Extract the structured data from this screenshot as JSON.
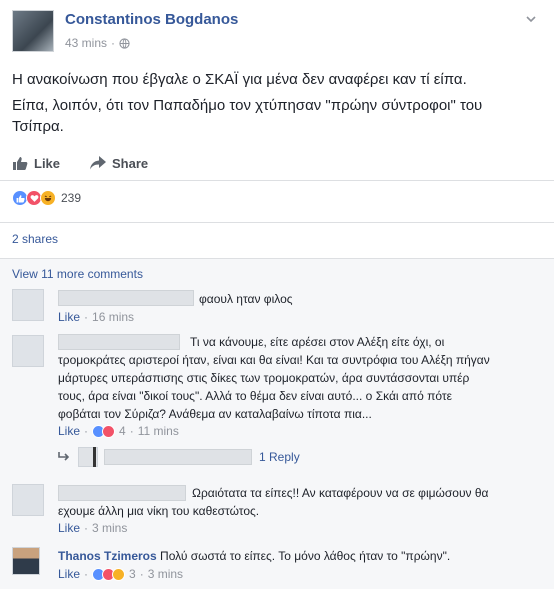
{
  "post": {
    "author": "Constantinos Bogdanos",
    "time": "43 mins",
    "sep": "·",
    "text1": "Η ανακοίνωση που έβγαλε ο ΣΚΑΪ για μένα δεν αναφέρει καν τί είπα.",
    "text2": "Είπα, λοιπόν, ότι τον Παπαδήμο τον χτύπησαν \"πρώην σύντροφοι\" του Τσίπρα."
  },
  "actions": {
    "like": "Like",
    "share": "Share"
  },
  "reactions": {
    "count": "239",
    "icons": [
      "like-icon",
      "love-icon",
      "haha-icon"
    ]
  },
  "shares": "2 shares",
  "view_more": "View 11 more comments",
  "comments": [
    {
      "text": "φαουλ ηταν φιλος",
      "like": "Like",
      "sep": "·",
      "time": "16 mins"
    },
    {
      "lines": [
        "Τι να κάνουμε, είτε αρέσει στον Αλέξη είτε όχι, οι",
        "τρομοκράτες αριστεροί ήταν, είναι και θα είναι! Και τα συντρόφια του Αλέξη πήγαν",
        "μάρτυρες υπεράσπισης στις δίκες των τρομοκρατών, άρα συντάσσονται υπέρ",
        "τους, άρα είναι \"δικοί τους\". Αλλά το θέμα δεν είναι αυτό... ο Σκάι από πότε",
        "φοβάται τον Σύριζα? Ανάθεμα αν καταλαβαίνω τίποτα πια..."
      ],
      "like": "Like",
      "sep": "·",
      "reactions": "4",
      "time": "11 mins",
      "reply": "1 Reply"
    },
    {
      "lines": [
        "Ωραιότατα τα είπες!! Αν καταφέρουν να σε φιμώσουν θα",
        "εχουμε άλλη μια νίκη του καθεστώτος."
      ],
      "like": "Like",
      "sep": "·",
      "time": "3 mins"
    },
    {
      "name": "Thanos Tzimeros",
      "text": "Πολύ σωστά το είπες. Το μόνο λάθος ήταν το \"πρώην\".",
      "like": "Like",
      "sep": "·",
      "reactions": "3",
      "time": "3 mins"
    }
  ],
  "colors": {
    "link": "#365899",
    "meta": "#90949c",
    "like": "#5890ff",
    "love": "#f25268",
    "haha": "#f7b125"
  }
}
